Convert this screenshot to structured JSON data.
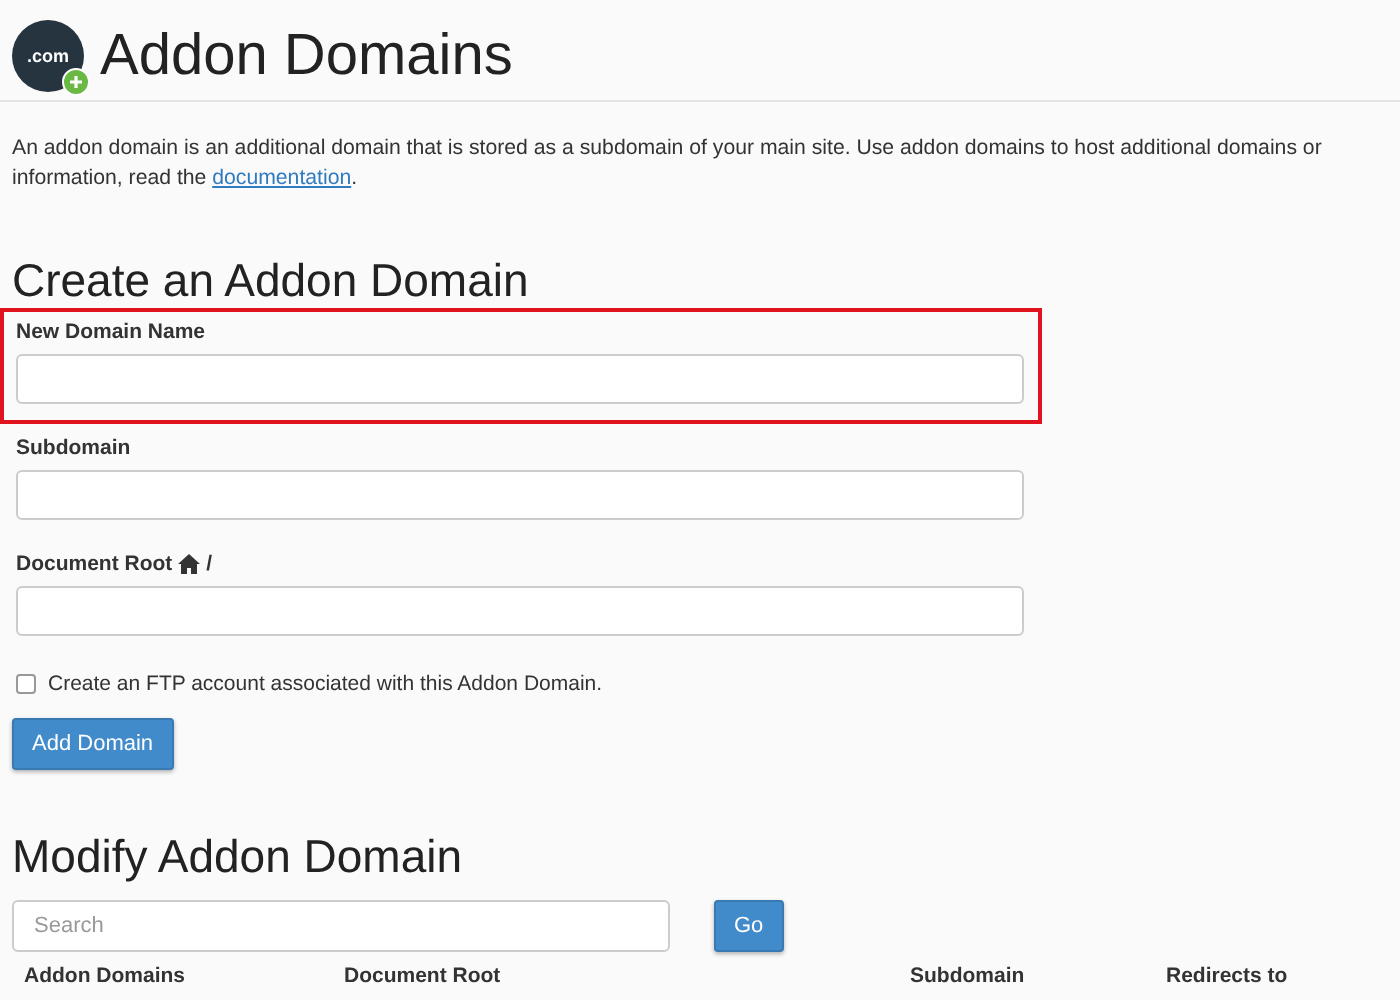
{
  "header": {
    "icon_text": ".com",
    "title": "Addon Domains"
  },
  "description": {
    "line_1": "An addon domain is an additional domain that is stored as a subdomain of your main site. Use addon domains to host additional domains or",
    "line_2_before": "information, read the ",
    "link": "documentation",
    "line_2_after": "."
  },
  "create_section": {
    "title": "Create an Addon Domain",
    "fields": [
      {
        "label": "New Domain Name",
        "highlighted": true,
        "home_icon": false
      },
      {
        "label": "Subdomain",
        "highlighted": false,
        "home_icon": false
      },
      {
        "label": "Document Root",
        "highlighted": false,
        "home_icon": true,
        "suffix": "/"
      }
    ],
    "ftp_checkbox": {
      "label": "Create an FTP account associated with this Addon Domain.",
      "checked": false
    },
    "submit_button": "Add Domain"
  },
  "modify_section": {
    "title": "Modify Addon Domain",
    "search": {
      "placeholder": "Search"
    },
    "go_button": "Go",
    "table": {
      "columns": [
        "Addon Domains",
        "Document Root",
        "Subdomain",
        "Redirects to"
      ]
    }
  }
}
